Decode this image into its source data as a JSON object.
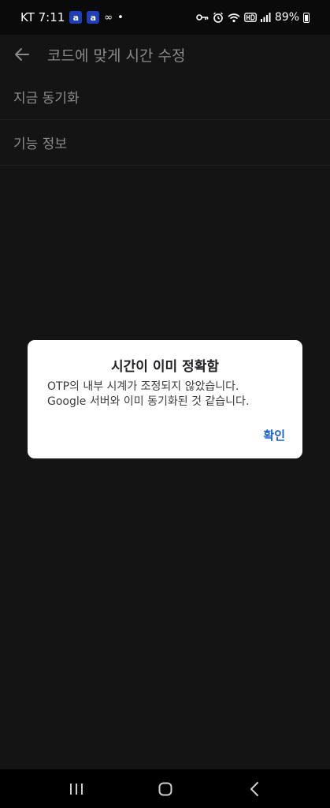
{
  "status_bar": {
    "carrier_time": "KT 7:11",
    "badge_1": "a",
    "badge_2": "a",
    "infinity_glyph": "∞",
    "dot_glyph": "•",
    "battery": "89%",
    "icons": [
      "key-icon",
      "alarm-icon",
      "wifi-icon",
      "hd-icon",
      "signal-icon",
      "battery-icon"
    ]
  },
  "app_bar": {
    "title": "코드에 맞게 시간 수정",
    "back_icon": "arrow-left-icon"
  },
  "menu": {
    "items": [
      {
        "label": "지금 동기화"
      },
      {
        "label": "기능 정보"
      }
    ]
  },
  "dialog": {
    "title": "시간이 이미 정확함",
    "message_line_1": "OTP의 내부 시계가 조정되지 않았습니다.",
    "message_line_2": "Google 서버와 이미 동기화된 것 같습니다.",
    "confirm_label": "확인"
  },
  "nav_bar": {
    "icons": [
      "recents-icon",
      "home-icon",
      "back-icon"
    ]
  },
  "colors": {
    "accent": "#1a5fc8",
    "background": "#141414",
    "dialog_background": "#ffffff"
  }
}
